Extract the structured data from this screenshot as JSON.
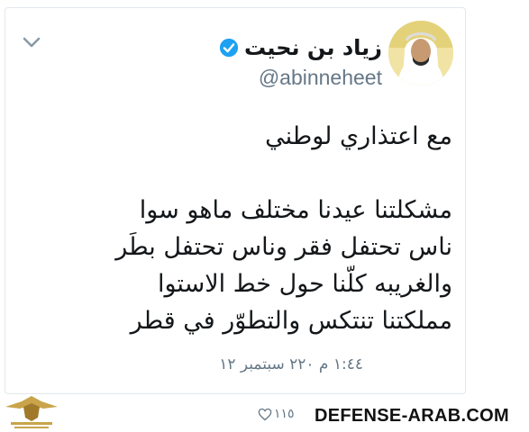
{
  "tweet": {
    "display_name": "زياد بن نحيت",
    "handle": "@abinneheet",
    "text_lines": [
      "مع اعتذاري لوطني",
      "",
      "مشكلتنا عيدنا مختلف ماهو سوا",
      "ناس تحتفل فقر وناس تحتفل بطَر",
      "والغريبه كلّنا حول خط الاستوا",
      "مملكتنا تنتكس والتطوّر في قطر"
    ],
    "timestamp": "١:٤٤ م ٢٢٠ سبتمبر ١٢",
    "likes": "١١٥",
    "icons": {
      "menu": "chevron-down-icon",
      "verified": "verified-badge-icon",
      "like": "heart-icon"
    },
    "colors": {
      "verified_blue": "#1da1f2",
      "secondary_text": "#657786",
      "primary_text": "#14171a"
    }
  },
  "watermark": {
    "site": "DEFENSE-ARAB.COM"
  }
}
